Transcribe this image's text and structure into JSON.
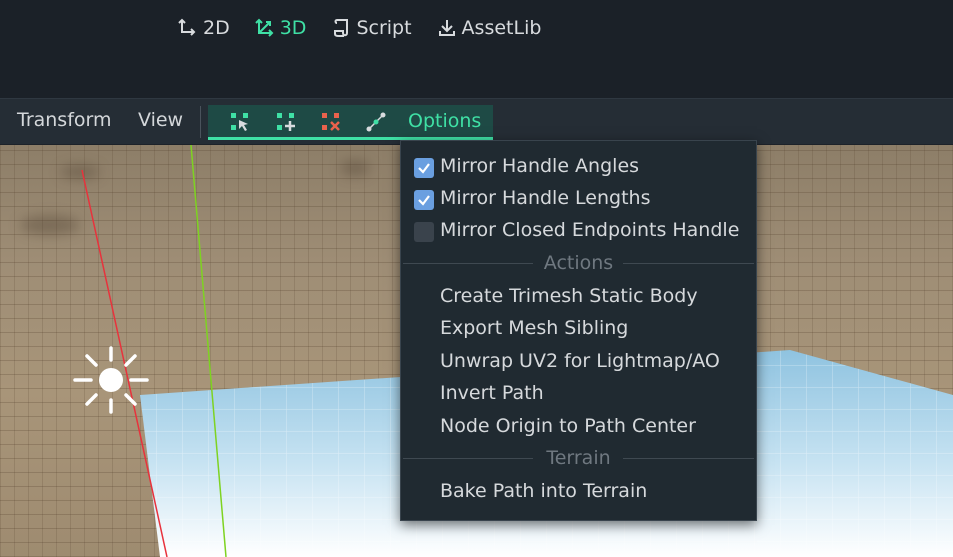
{
  "main_tabs": [
    {
      "label": "2D",
      "icon": "2d-icon",
      "active": false
    },
    {
      "label": "3D",
      "icon": "3d-icon",
      "active": true
    },
    {
      "label": "Script",
      "icon": "script-icon",
      "active": false
    },
    {
      "label": "AssetLib",
      "icon": "assetlib-icon",
      "active": false
    }
  ],
  "toolbar": {
    "transform_label": "Transform",
    "view_label": "View",
    "path_tools": [
      "select-points-icon",
      "add-point-icon",
      "delete-point-icon",
      "edit-curve-icon"
    ],
    "options_label": "Options"
  },
  "options_menu": {
    "checks": [
      {
        "label": "Mirror Handle Angles",
        "checked": true
      },
      {
        "label": "Mirror Handle Lengths",
        "checked": true
      },
      {
        "label": "Mirror Closed Endpoints Handle",
        "checked": false
      }
    ],
    "actions_header": "Actions",
    "actions": [
      "Create Trimesh Static Body",
      "Export Mesh Sibling",
      "Unwrap UV2 for Lightmap/AO",
      "Invert Path",
      "Node Origin to Path Center"
    ],
    "terrain_header": "Terrain",
    "terrain_actions": [
      "Bake Path into Terrain"
    ]
  },
  "colors": {
    "accent": "#3fe0a5",
    "checkbox_on": "#6a9fe0",
    "x_axis": "#e8323c",
    "y_axis": "#7ed321"
  }
}
